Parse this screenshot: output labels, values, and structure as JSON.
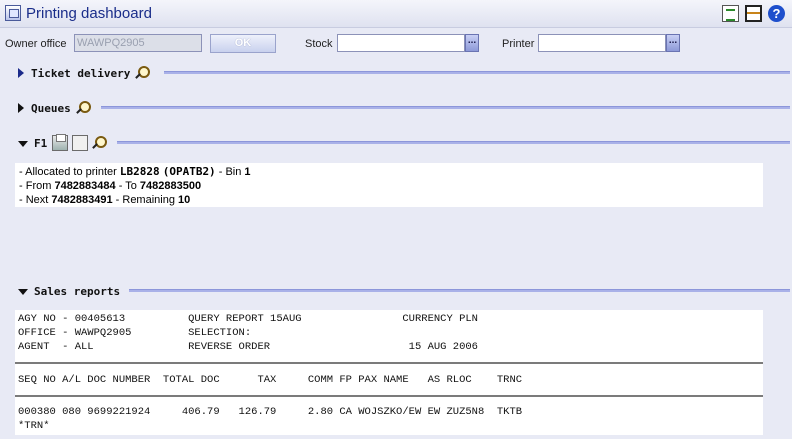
{
  "app": {
    "title": "Printing dashboard"
  },
  "toolbar": {
    "doc_icon": "document-icon",
    "window_icon": "window-icon",
    "help_icon": "help-icon",
    "help_glyph": "?"
  },
  "filters": {
    "owner_office_label": "Owner office",
    "owner_office_value": "WAWPQ2905",
    "ok_label": "OK",
    "stock_label": "Stock",
    "stock_value": "",
    "printer_label": "Printer",
    "printer_value": "",
    "ellipsis": "..."
  },
  "sections": {
    "ticket_delivery": "Ticket delivery",
    "queues": "Queues",
    "f1": "F1",
    "sales_reports": "Sales reports"
  },
  "f1": {
    "line1_prefix": "- Allocated to printer ",
    "printer": "LB2828",
    "printer_code": "(OPATB2)",
    "bin_prefix": " - Bin ",
    "bin": "1",
    "from_prefix": "- From ",
    "from": "7482883484",
    "to_prefix": " - To ",
    "to": "7482883500",
    "next_prefix": "- Next ",
    "next": "7482883491",
    "remaining_prefix": " - Remaining ",
    "remaining": "10"
  },
  "sales_report": {
    "header_lines": [
      "AGY NO - 00405613          QUERY REPORT 15AUG                CURRENCY PLN",
      "OFFICE - WAWPQ2905         SELECTION:",
      "AGENT  - ALL               REVERSE ORDER                      15 AUG 2006"
    ],
    "column_header": "SEQ NO A/L DOC NUMBER  TOTAL DOC      TAX     COMM FP PAX NAME   AS RLOC    TRNC",
    "rows": [
      "000380 080 9699221924     406.79   126.79     2.80 CA WOJSZKO/EW EW ZUZ5N8  TKTB",
      "*TRN*"
    ]
  }
}
